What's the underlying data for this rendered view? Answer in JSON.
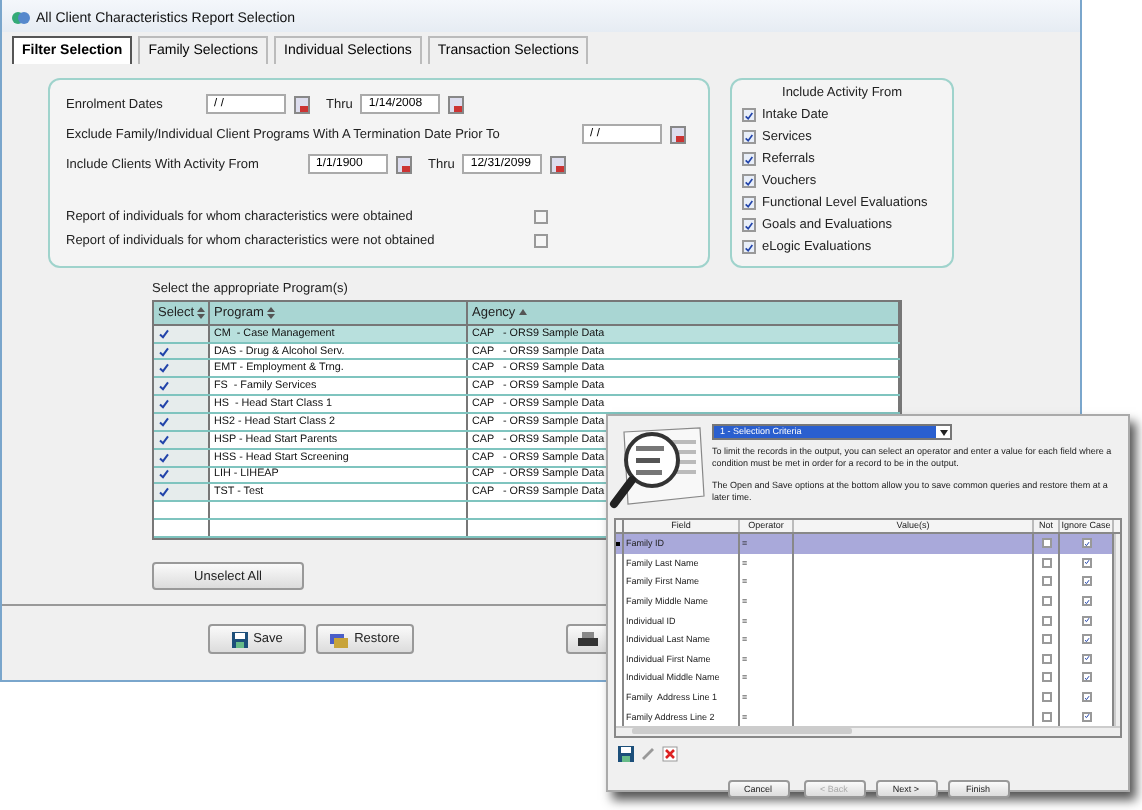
{
  "window": {
    "title": "All Client Characteristics Report Selection"
  },
  "tabs": [
    {
      "label": "Filter Selection",
      "selected": true
    },
    {
      "label": "Family Selections",
      "selected": false
    },
    {
      "label": "Individual Selections",
      "selected": false
    },
    {
      "label": "Transaction Selections",
      "selected": false
    }
  ],
  "date_rows": [
    {
      "label": "Enrolment Dates",
      "from": "/ /",
      "thru": "Thru",
      "to": "1/14/2008"
    },
    {
      "label": "Exclude Family/Individual Client Programs With A Termination Date Prior To",
      "from": "/ /"
    },
    {
      "label": "Include Clients With Activity From",
      "from": "1/1/1900",
      "thru": "Thru",
      "to": "12/31/2099"
    }
  ],
  "report_options": [
    {
      "label": "Report of individuals for whom characteristics were obtained",
      "checked": false
    },
    {
      "label": "Report of individuals for whom characteristics were not obtained",
      "checked": false
    }
  ],
  "include_activity": {
    "title": "Include Activity From",
    "items": [
      {
        "label": "Intake Date",
        "checked": true
      },
      {
        "label": "Services",
        "checked": true
      },
      {
        "label": "Referrals",
        "checked": true
      },
      {
        "label": "Vouchers",
        "checked": true
      },
      {
        "label": "Functional Level Evaluations",
        "checked": true
      },
      {
        "label": "Goals and Evaluations",
        "checked": true
      },
      {
        "label": "eLogic Evaluations",
        "checked": true
      }
    ]
  },
  "programs": {
    "caption": "Select the appropriate Program(s)",
    "columns": [
      "Select",
      "Program",
      "Agency"
    ],
    "rows": [
      {
        "selected": true,
        "checked": true,
        "program": "CM  - Case Management",
        "agency": "CAP   - ORS9 Sample Data"
      },
      {
        "selected": false,
        "checked": true,
        "program": "DAS - Drug & Alcohol Serv.",
        "agency": "CAP   - ORS9 Sample Data"
      },
      {
        "selected": false,
        "checked": true,
        "program": "EMT - Employment & Trng.",
        "agency": "CAP   - ORS9 Sample Data"
      },
      {
        "selected": false,
        "checked": true,
        "program": "FS  - Family Services",
        "agency": "CAP   - ORS9 Sample Data"
      },
      {
        "selected": false,
        "checked": true,
        "program": "HS  - Head Start Class 1",
        "agency": "CAP   - ORS9 Sample Data"
      },
      {
        "selected": false,
        "checked": true,
        "program": "HS2 - Head Start Class 2",
        "agency": "CAP   - ORS9 Sample Data"
      },
      {
        "selected": false,
        "checked": true,
        "program": "HSP - Head Start Parents",
        "agency": "CAP   - ORS9 Sample Data"
      },
      {
        "selected": false,
        "checked": true,
        "program": "HSS - Head Start Screening",
        "agency": "CAP   - ORS9 Sample Data"
      },
      {
        "selected": false,
        "checked": true,
        "program": "LIH - LIHEAP",
        "agency": "CAP   - ORS9 Sample Data"
      },
      {
        "selected": false,
        "checked": true,
        "program": "TST - Test",
        "agency": "CAP   - ORS9 Sample Data"
      }
    ]
  },
  "unselect_button": "Unselect All",
  "footer_buttons": [
    "Save",
    "Restore"
  ],
  "dialog": {
    "dropdown": "1 - Selection Criteria",
    "paragraphs": [
      "To limit the records in the output, you can select an operator and enter a value for each field where a condition must be met in order for a record to be in the output.",
      "The Open and Save options at the bottom allow you to save common queries and restore them at a later time."
    ],
    "columns": [
      "Field",
      "Operator",
      "Value(s)",
      "Not",
      "Ignore Case"
    ],
    "rows": [
      {
        "field": "Family ID",
        "operator": "=",
        "not": false,
        "ignore_case": true,
        "selected": true
      },
      {
        "field": "Family Last Name",
        "operator": "=",
        "not": false,
        "ignore_case": true,
        "selected": false
      },
      {
        "field": "Family First Name",
        "operator": "=",
        "not": false,
        "ignore_case": true,
        "selected": false
      },
      {
        "field": "Family Middle Name",
        "operator": "=",
        "not": false,
        "ignore_case": true,
        "selected": false
      },
      {
        "field": "Individual ID",
        "operator": "=",
        "not": false,
        "ignore_case": true,
        "selected": false
      },
      {
        "field": "Individual Last Name",
        "operator": "=",
        "not": false,
        "ignore_case": true,
        "selected": false
      },
      {
        "field": "Individual First Name",
        "operator": "=",
        "not": false,
        "ignore_case": true,
        "selected": false
      },
      {
        "field": "Individual Middle Name",
        "operator": "=",
        "not": false,
        "ignore_case": true,
        "selected": false
      },
      {
        "field": "Family  Address Line 1",
        "operator": "=",
        "not": false,
        "ignore_case": true,
        "selected": false
      },
      {
        "field": "Family Address Line 2",
        "operator": "=",
        "not": false,
        "ignore_case": true,
        "selected": false
      }
    ],
    "buttons": [
      {
        "label": "Cancel",
        "disabled": false
      },
      {
        "label": "< Back",
        "disabled": true
      },
      {
        "label": "Next >",
        "disabled": false
      },
      {
        "label": "Finish",
        "disabled": false
      }
    ]
  }
}
